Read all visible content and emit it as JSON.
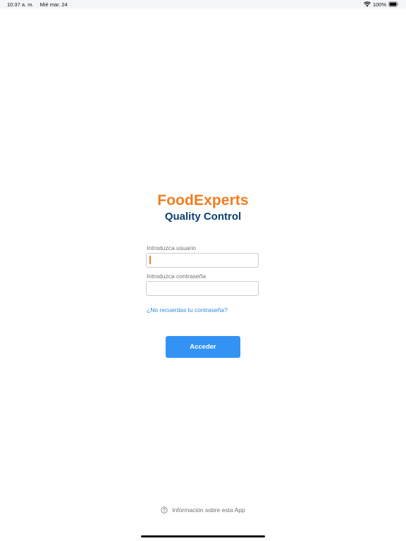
{
  "status_bar": {
    "time": "10:37 a. m.",
    "date": "Mié mar. 24",
    "battery": "100%"
  },
  "brand": {
    "name": "FoodExperts",
    "subtitle": "Quality Control"
  },
  "form": {
    "username_label": "Introduzca usuario",
    "username_value": "",
    "password_label": "Introduzca contraseña",
    "password_value": "",
    "forgot_link": "¿No recuerdas tu contraseña?",
    "submit_label": "Acceder"
  },
  "footer": {
    "info_label": "Información sobre esta App"
  },
  "colors": {
    "brand_orange": "#ef7d22",
    "brand_navy": "#0e3f73",
    "accent_blue": "#3393f4",
    "link_blue": "#2f87df"
  },
  "icons": {
    "wifi": "wifi-icon",
    "battery": "battery-icon",
    "info": "info-circle-icon"
  }
}
